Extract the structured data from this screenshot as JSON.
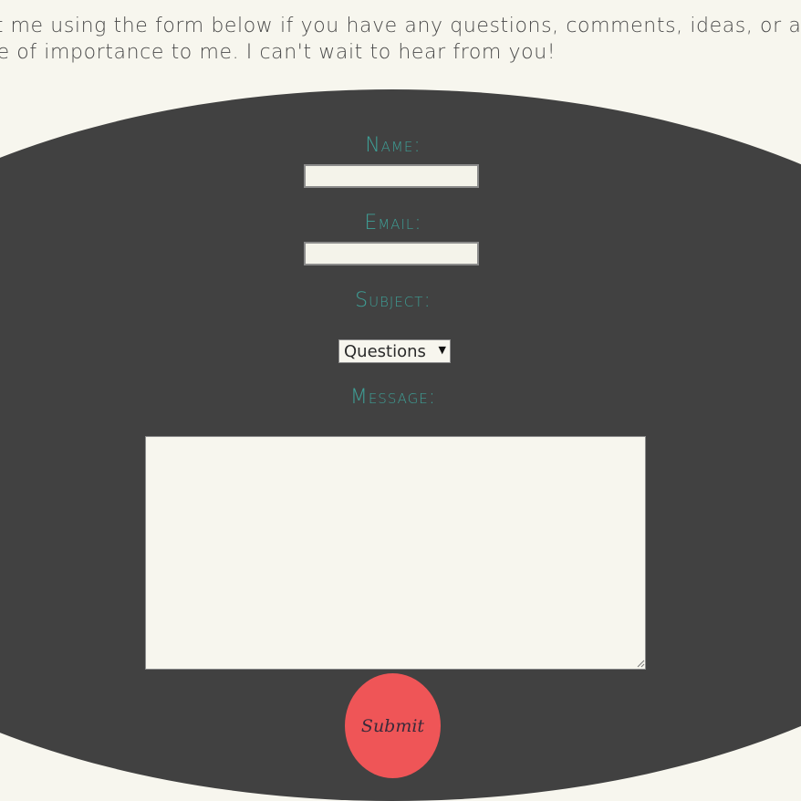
{
  "intro": {
    "line1": "ct me using the form below if you have any questions, comments, ideas, or any othe",
    "line2": "pe of importance to me. I can't wait to hear from you!"
  },
  "form": {
    "name_label": "Name:",
    "name_value": "",
    "email_label": "Email:",
    "email_value": "",
    "subject_label": "Subject:",
    "subject_selected": "Questions",
    "message_label": "Message:",
    "message_value": "",
    "submit_label": "Submit"
  },
  "colors": {
    "background": "#f7f6ee",
    "oval": "#414141",
    "label": "#3e9f96",
    "submit": "#ef5557"
  },
  "icons": {
    "select_arrow": "triangle-down-icon",
    "resize_grip": "resize-grip-icon"
  }
}
